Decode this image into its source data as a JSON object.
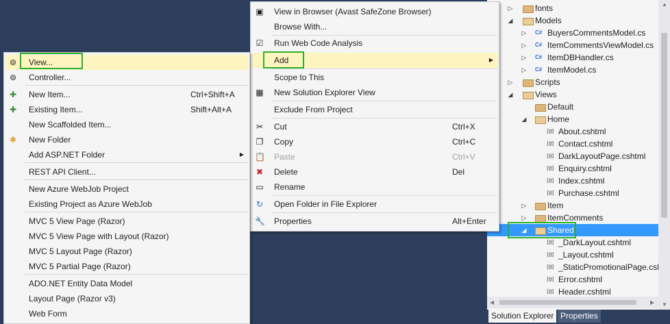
{
  "tree": {
    "items": [
      {
        "label": "fonts",
        "icon": "folder-icon",
        "expander": "▷"
      },
      {
        "label": "Models",
        "icon": "folder-open-icon",
        "expander": "◢"
      },
      {
        "label": "BuyersCommentsModel.cs",
        "icon": "cs-icon",
        "icon_text": "C#",
        "expander": "▷"
      },
      {
        "label": "ItemCommentsViewModel.cs",
        "icon": "cs-icon",
        "icon_text": "C#",
        "expander": "▷"
      },
      {
        "label": "ItemDBHandler.cs",
        "icon": "cs-icon",
        "icon_text": "C#",
        "expander": "▷"
      },
      {
        "label": "ItemModel.cs",
        "icon": "cs-icon",
        "icon_text": "C#",
        "expander": "▷"
      },
      {
        "label": "Scripts",
        "icon": "folder-icon",
        "expander": "▷"
      },
      {
        "label": "Views",
        "icon": "folder-open-icon",
        "expander": "◢"
      },
      {
        "label": "Default",
        "icon": "folder-icon",
        "expander": ""
      },
      {
        "label": "Home",
        "icon": "folder-open-icon",
        "expander": "◢"
      },
      {
        "label": "About.cshtml",
        "icon": "cshtml-icon",
        "icon_text": "[@]",
        "expander": ""
      },
      {
        "label": "Contact.cshtml",
        "icon": "cshtml-icon",
        "icon_text": "[@]",
        "expander": ""
      },
      {
        "label": "DarkLayoutPage.cshtml",
        "icon": "cshtml-icon",
        "icon_text": "[@]",
        "expander": ""
      },
      {
        "label": "Enquiry.cshtml",
        "icon": "cshtml-icon",
        "icon_text": "[@]",
        "expander": ""
      },
      {
        "label": "Index.cshtml",
        "icon": "cshtml-icon",
        "icon_text": "[@]",
        "expander": ""
      },
      {
        "label": "Purchase.cshtml",
        "icon": "cshtml-icon",
        "icon_text": "[@]",
        "expander": ""
      },
      {
        "label": "Item",
        "icon": "folder-icon",
        "expander": "▷"
      },
      {
        "label": "ItemComments",
        "icon": "folder-icon",
        "expander": "▷"
      },
      {
        "label": "Shared",
        "icon": "folder-open-icon",
        "expander": "◢",
        "selected": true
      },
      {
        "label": "_DarkLayout.cshtml",
        "icon": "cshtml-icon",
        "icon_text": "[@]",
        "expander": ""
      },
      {
        "label": "_Layout.cshtml",
        "icon": "cshtml-icon",
        "icon_text": "[@]",
        "expander": ""
      },
      {
        "label": "_StaticPromotionalPage.cshtml",
        "icon": "cshtml-icon",
        "icon_text": "[@]",
        "expander": ""
      },
      {
        "label": "Error.cshtml",
        "icon": "cshtml-icon",
        "icon_text": "[@]",
        "expander": ""
      },
      {
        "label": "Header.cshtml",
        "icon": "cshtml-icon",
        "icon_text": "[@]",
        "expander": ""
      }
    ]
  },
  "panel_tabs": {
    "solution_explorer": "Solution Explorer",
    "properties": "Properties"
  },
  "context_menu": {
    "items": [
      {
        "label": "View in Browser (Avast SafeZone Browser)",
        "icon": "browser-icon",
        "glyph": "▣"
      },
      {
        "label": "Browse With...",
        "icon": "",
        "glyph": ""
      },
      {
        "label": "Run Web Code Analysis",
        "icon": "code-analysis-icon",
        "glyph": "☑"
      },
      {
        "label": "Add",
        "icon": "",
        "glyph": "",
        "submenu": true,
        "highlight": true
      },
      {
        "label": "Scope to This",
        "icon": "",
        "glyph": ""
      },
      {
        "label": "New Solution Explorer View",
        "icon": "solution-view-icon",
        "glyph": "▦"
      },
      {
        "label": "Exclude From Project",
        "icon": "",
        "glyph": ""
      },
      {
        "label": "Cut",
        "icon": "cut-icon",
        "glyph": "✂",
        "shortcut": "Ctrl+X"
      },
      {
        "label": "Copy",
        "icon": "copy-icon",
        "glyph": "❐",
        "shortcut": "Ctrl+C"
      },
      {
        "label": "Paste",
        "icon": "paste-icon",
        "glyph": "📋",
        "shortcut": "Ctrl+V",
        "disabled": true
      },
      {
        "label": "Delete",
        "icon": "delete-icon",
        "glyph": "✖",
        "shortcut": "Del"
      },
      {
        "label": "Rename",
        "icon": "rename-icon",
        "glyph": "▭"
      },
      {
        "label": "Open Folder in File Explorer",
        "icon": "refresh-icon",
        "glyph": "↻"
      },
      {
        "label": "Properties",
        "icon": "wrench-icon",
        "glyph": "🔧",
        "shortcut": "Alt+Enter"
      }
    ]
  },
  "add_menu": {
    "items": [
      {
        "label": "View...",
        "icon": "view-icon",
        "glyph": "⊚",
        "highlight": true
      },
      {
        "label": "Controller...",
        "icon": "controller-icon",
        "glyph": "⊚"
      },
      {
        "label": "New Item...",
        "icon": "new-item-icon",
        "glyph": "✚",
        "shortcut": "Ctrl+Shift+A"
      },
      {
        "label": "Existing Item...",
        "icon": "existing-item-icon",
        "glyph": "✚",
        "shortcut": "Shift+Alt+A"
      },
      {
        "label": "New Scaffolded Item...",
        "icon": "",
        "glyph": ""
      },
      {
        "label": "New Folder",
        "icon": "new-folder-icon",
        "glyph": "✱"
      },
      {
        "label": "Add ASP.NET Folder",
        "icon": "",
        "glyph": "",
        "submenu": true
      },
      {
        "label": "REST API Client...",
        "icon": "",
        "glyph": ""
      },
      {
        "label": "New Azure WebJob Project",
        "icon": "",
        "glyph": ""
      },
      {
        "label": "Existing Project as Azure WebJob",
        "icon": "",
        "glyph": ""
      },
      {
        "label": "MVC 5 View Page (Razor)",
        "icon": "",
        "glyph": ""
      },
      {
        "label": "MVC 5 View Page with Layout (Razor)",
        "icon": "",
        "glyph": ""
      },
      {
        "label": "MVC 5 Layout Page (Razor)",
        "icon": "",
        "glyph": ""
      },
      {
        "label": "MVC 5 Partial Page (Razor)",
        "icon": "",
        "glyph": ""
      },
      {
        "label": "ADO.NET Entity Data Model",
        "icon": "",
        "glyph": ""
      },
      {
        "label": "Layout Page (Razor v3)",
        "icon": "",
        "glyph": ""
      },
      {
        "label": "Web Form",
        "icon": "",
        "glyph": ""
      }
    ]
  },
  "colors": {
    "accent_selection": "#3399ff",
    "menu_highlight": "#fdf4bf",
    "annotation_box": "#2db02d",
    "background": "#2d3e5c"
  }
}
